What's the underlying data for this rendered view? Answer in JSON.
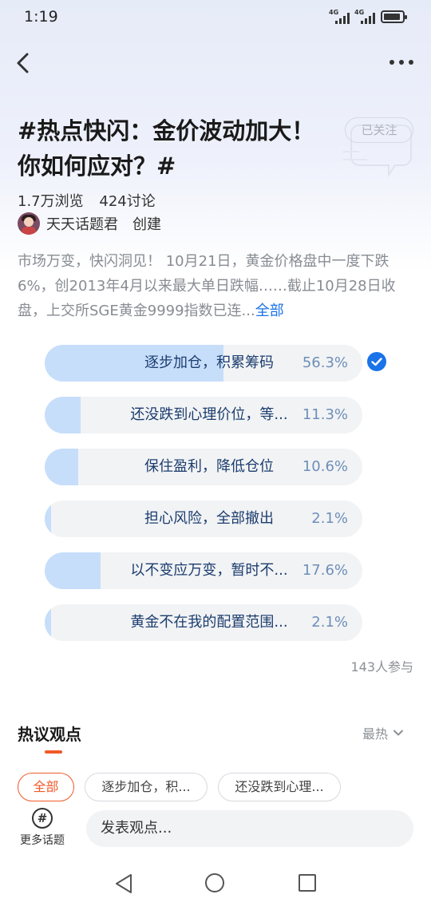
{
  "status_bar": {
    "time": "1:19",
    "signal_1_label": "4G",
    "signal_2_label": "4G",
    "battery_icon": "battery-icon"
  },
  "header": {
    "back_icon": "back-arrow-icon",
    "more_icon": "more-dots-icon"
  },
  "topic": {
    "title": "#热点快闪：金价波动加大！你如何应对？#",
    "follow_label": "已关注",
    "views": "1.7万浏览",
    "discussions": "424讨论",
    "creator_name": "天天话题君",
    "creator_action": "创建",
    "description": "市场万变，快闪洞见！ 10月21日，黄金价格盘中一度下跌6%，创2013年4月以来最大单日跌幅……截止10月28日收盘，上交所SGE黄金9999指数已连...",
    "expand_label": "全部"
  },
  "poll": {
    "options": [
      {
        "label": "逐步加仓，积累筹码",
        "percent": "56.3%",
        "fraction": 0.563,
        "selected": true
      },
      {
        "label": "还没跌到心理价位，等...",
        "percent": "11.3%",
        "fraction": 0.113,
        "selected": false
      },
      {
        "label": "保住盈利，降低仓位",
        "percent": "10.6%",
        "fraction": 0.106,
        "selected": false
      },
      {
        "label": "担心风险，全部撤出",
        "percent": "2.1%",
        "fraction": 0.021,
        "selected": false
      },
      {
        "label": "以不变应万变，暂时不...",
        "percent": "17.6%",
        "fraction": 0.176,
        "selected": false
      },
      {
        "label": "黄金不在我的配置范围...",
        "percent": "2.1%",
        "fraction": 0.021,
        "selected": false
      }
    ],
    "participants": "143人参与"
  },
  "discussion": {
    "section_title": "热议观点",
    "sort_label": "最热",
    "filters": [
      "全部",
      "逐步加仓，积...",
      "还没跌到心理..."
    ]
  },
  "bottom_bar": {
    "more_topics_label": "更多话题",
    "comment_placeholder": "发表观点..."
  },
  "colors": {
    "accent": "#f05a28",
    "poll_fill": "#c7defb",
    "poll_text": "#1b3d6e",
    "link": "#1a73e8"
  }
}
